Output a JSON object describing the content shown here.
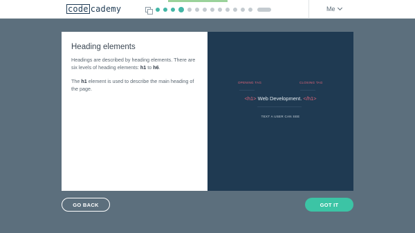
{
  "header": {
    "logo": {
      "boxed": "code",
      "rest": "cademy"
    },
    "progress": {
      "icon": "copy-icon",
      "steps": [
        "done",
        "done",
        "done",
        "current",
        "todo",
        "todo",
        "todo",
        "todo",
        "todo",
        "todo",
        "todo",
        "todo",
        "todo"
      ],
      "accent_color": "#43b6a6"
    },
    "user_menu": {
      "label": "Me",
      "icon": "chevron-down-icon"
    }
  },
  "lesson": {
    "title": "Heading elements",
    "para1": {
      "text": "Headings are described by heading elements. There are six levels of heading elements: ",
      "first": "h1",
      "mid": " to ",
      "last": "h6",
      "end": "."
    },
    "para2": {
      "prefix": "The ",
      "tag": "h1",
      "suffix": " element is used to describe the main heading of the page."
    }
  },
  "diagram": {
    "opening_label": "OPENING TAG",
    "closing_label": "CLOSING TAG",
    "open_tag": "<h1>",
    "content": " Web Development. ",
    "close_tag": "</h1>",
    "caption": "TEXT A USER CAN SEE",
    "tag_color": "#e6667a"
  },
  "buttons": {
    "back": "GO BACK",
    "next": "GOT IT"
  }
}
